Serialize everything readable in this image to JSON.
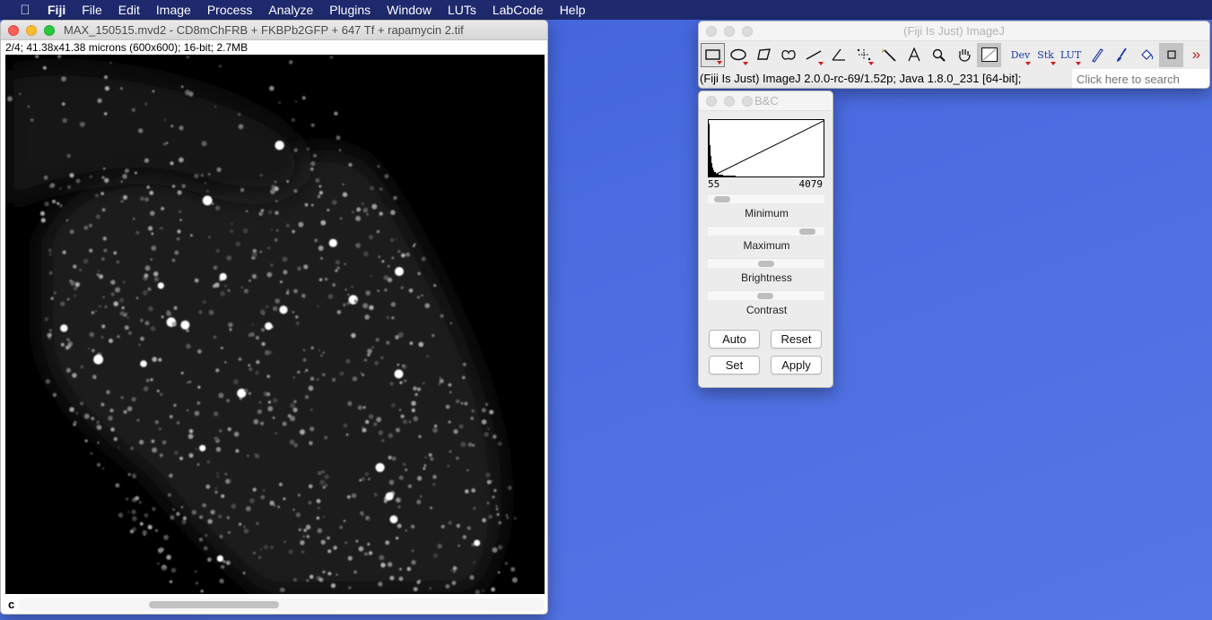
{
  "menubar": {
    "apple_icon": "apple-icon",
    "items": [
      "Fiji",
      "File",
      "Edit",
      "Image",
      "Process",
      "Analyze",
      "Plugins",
      "Window",
      "LUTs",
      "LabCode",
      "Help"
    ]
  },
  "image_window": {
    "title": "MAX_150515.mvd2 - CD8mChFRB + FKBPb2GFP + 647 Tf + rapamycin 2.tif",
    "info": "2/4; 41.38x41.38 microns (600x600); 16-bit; 2.7MB",
    "channel_label": "c",
    "colors": {
      "background": "#000000",
      "spots": "#ffffff"
    }
  },
  "imagej_window": {
    "title": "(Fiji Is Just) ImageJ",
    "tools": [
      {
        "name": "rectangle-tool",
        "icon": "rectangle-icon"
      },
      {
        "name": "oval-tool",
        "icon": "oval-icon"
      },
      {
        "name": "polygon-tool",
        "icon": "polygon-icon"
      },
      {
        "name": "freehand-tool",
        "icon": "freehand-icon"
      },
      {
        "name": "line-tool",
        "icon": "line-icon"
      },
      {
        "name": "angle-tool",
        "icon": "angle-icon"
      },
      {
        "name": "point-tool",
        "icon": "multipoint-icon"
      },
      {
        "name": "wand-tool",
        "icon": "wand-icon"
      },
      {
        "name": "text-tool",
        "icon": "text-icon"
      },
      {
        "name": "magnifier-tool",
        "icon": "magnifier-icon"
      },
      {
        "name": "hand-tool",
        "icon": "hand-icon"
      },
      {
        "name": "color-picker-tool",
        "icon": "dropper-icon"
      }
    ],
    "extra_tools": [
      "Dev",
      "Stk",
      "LUT"
    ],
    "status": "(Fiji Is Just) ImageJ 2.0.0-rc-69/1.52p; Java 1.8.0_231 [64-bit];",
    "search_placeholder": "Click here to search"
  },
  "bc_window": {
    "title": "B&C",
    "hist_min": "55",
    "hist_max": "4079",
    "sliders": [
      {
        "label": "Minimum",
        "value": 0.05
      },
      {
        "label": "Maximum",
        "value": 0.93
      },
      {
        "label": "Brightness",
        "value": 0.5
      },
      {
        "label": "Contrast",
        "value": 0.49
      }
    ],
    "buttons": [
      "Auto",
      "Reset",
      "Set",
      "Apply"
    ]
  }
}
